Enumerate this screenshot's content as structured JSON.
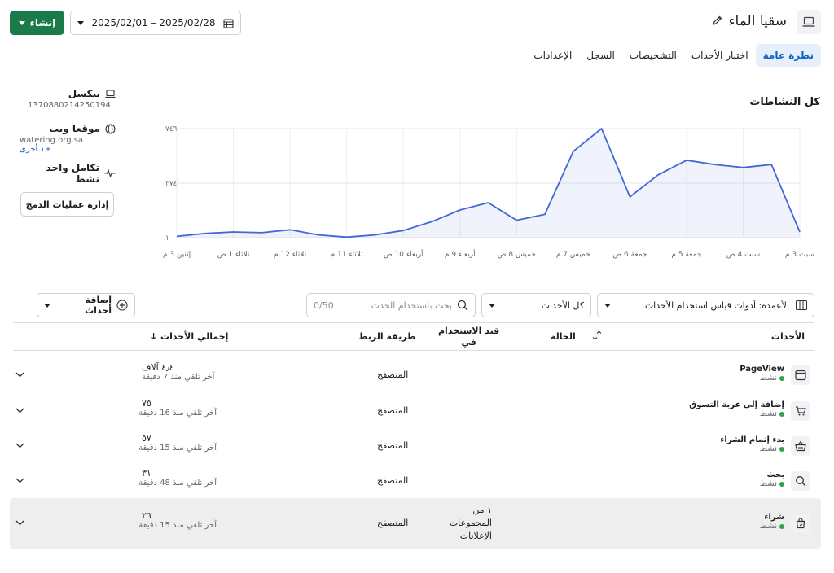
{
  "header": {
    "title": "سقيا الماء",
    "date_range": "2025/02/01 – 2025/02/28",
    "create_label": "إنشاء"
  },
  "tabs": [
    {
      "label": "نظرة عامة",
      "active": true
    },
    {
      "label": "اختبار الأحداث",
      "active": false
    },
    {
      "label": "التشخيصات",
      "active": false
    },
    {
      "label": "السجل",
      "active": false
    },
    {
      "label": "الإعدادات",
      "active": false
    }
  ],
  "info": {
    "pixel_title": "بيكسل",
    "pixel_id": "1370880214250194",
    "website_title": "موقعا ويب",
    "website_url": "watering.org.sa",
    "website_more": "+١ أخرى",
    "integration_title": "تكامل واحد نشط",
    "manage_button": "إدارة عمليات الدمج"
  },
  "chart_data": {
    "type": "area",
    "title": "كل النشاطات",
    "y_ticks": [
      "١",
      "٣٧٤",
      "٧٤٦"
    ],
    "ylim": [
      1,
      746
    ],
    "x_labels": [
      "سبت 3 م",
      "سبت 4 ص",
      "جمعة 5 م",
      "جمعة 6 ص",
      "خميس 7 م",
      "خميس 8 ص",
      "أربعاء 9 م",
      "أربعاء 10 ص",
      "ثلاثاء 11 م",
      "ثلاثاء 12 م",
      "ثلاثاء 1 ص",
      "إثنين 3 م"
    ],
    "series": [
      {
        "values": [
          10,
          30,
          40,
          35,
          55,
          20,
          5,
          20,
          50,
          110,
          190,
          240,
          120,
          160,
          590,
          746,
          280,
          430,
          530,
          500,
          480,
          500,
          40
        ]
      }
    ],
    "grid": true,
    "color": "#4267d6"
  },
  "filters": {
    "columns_label": "الأعمدة: أدوات قياس استخدام الأحداث",
    "events_filter": "كل الأحداث",
    "search_placeholder": "بحث باستخدام الحدث",
    "search_count": "0/50",
    "add_events": "إضافة أحداث"
  },
  "table": {
    "headers": {
      "events": "الأحداث",
      "status": "الحالة",
      "used_in_line1": "قيد الاستخدام",
      "used_in_line2": "في",
      "connection": "طريقة الربط",
      "total": "إجمالي الأحداث ↓"
    },
    "rows": [
      {
        "name": "PageView",
        "status": "نشط",
        "icon": "browser-window-icon",
        "used_in": "",
        "connection": "المتصفح",
        "total": "٤٫٤ آلاف",
        "received": "آخر تلقي منذ 7 دقيقة"
      },
      {
        "name": "إضافة إلى عربة التسوق",
        "status": "نشط",
        "icon": "cart-icon",
        "used_in": "",
        "connection": "المتصفح",
        "total": "٧٥",
        "received": "آخر تلقي منذ 16 دقيقة"
      },
      {
        "name": "بدء إتمام الشراء",
        "status": "نشط",
        "icon": "basket-icon",
        "used_in": "",
        "connection": "المتصفح",
        "total": "٥٧",
        "received": "آخر تلقي منذ 15 دقيقة"
      },
      {
        "name": "بحث",
        "status": "نشط",
        "icon": "search-icon",
        "used_in": "",
        "connection": "المتصفح",
        "total": "٣١",
        "received": "آخر تلقي منذ 48 دقيقة"
      },
      {
        "name": "شراء",
        "status": "نشط",
        "icon": "bag-icon",
        "used_in_lines": [
          "١ من",
          "المجموعات",
          "الإعلانات"
        ],
        "connection": "المتصفح",
        "total": "٢٦",
        "received": "آخر تلقي منذ 15 دقيقة"
      }
    ]
  }
}
